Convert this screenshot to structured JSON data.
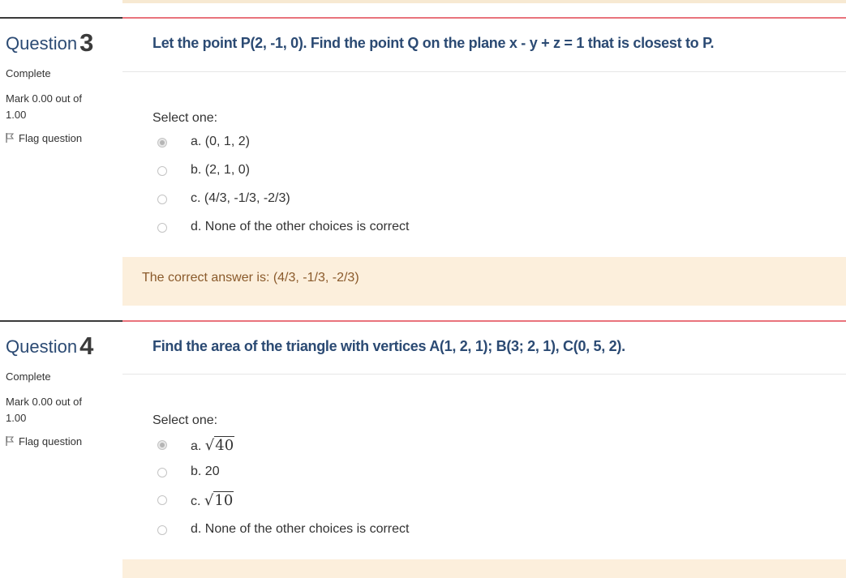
{
  "questions": [
    {
      "label": "Question",
      "number": "3",
      "state": "Complete",
      "grade": "Mark 0.00 out of 1.00",
      "flag_label": "Flag question",
      "text": "Let the point P(2, -1, 0). Find the point Q on the plane x - y + z = 1 that is  closest to P.",
      "prompt": "Select one:",
      "options": [
        {
          "letter": "a.",
          "text": "(0, 1, 2)",
          "checked": true
        },
        {
          "letter": "b.",
          "text": "(2, 1, 0)",
          "checked": false
        },
        {
          "letter": "c.",
          "text": "(4/3, -1/3, -2/3)",
          "checked": false
        },
        {
          "letter": "d.",
          "text": "None of the other choices is correct",
          "checked": false
        }
      ],
      "feedback": "The correct answer is: (4/3, -1/3, -2/3)"
    },
    {
      "label": "Question",
      "number": "4",
      "state": "Complete",
      "grade": "Mark 0.00 out of 1.00",
      "flag_label": "Flag question",
      "text": "Find the area of the triangle with vertices A(1, 2, 1); B(3; 2, 1), C(0, 5, 2).",
      "prompt": "Select one:",
      "options": [
        {
          "letter": "a.",
          "radical": "√",
          "radicand": "40",
          "checked": true
        },
        {
          "letter": "b.",
          "text": "20",
          "checked": false
        },
        {
          "letter": "c.",
          "radical": "√",
          "radicand": "10",
          "checked": false
        },
        {
          "letter": "d.",
          "text": "None of the other choices is correct",
          "checked": false
        }
      ]
    }
  ]
}
